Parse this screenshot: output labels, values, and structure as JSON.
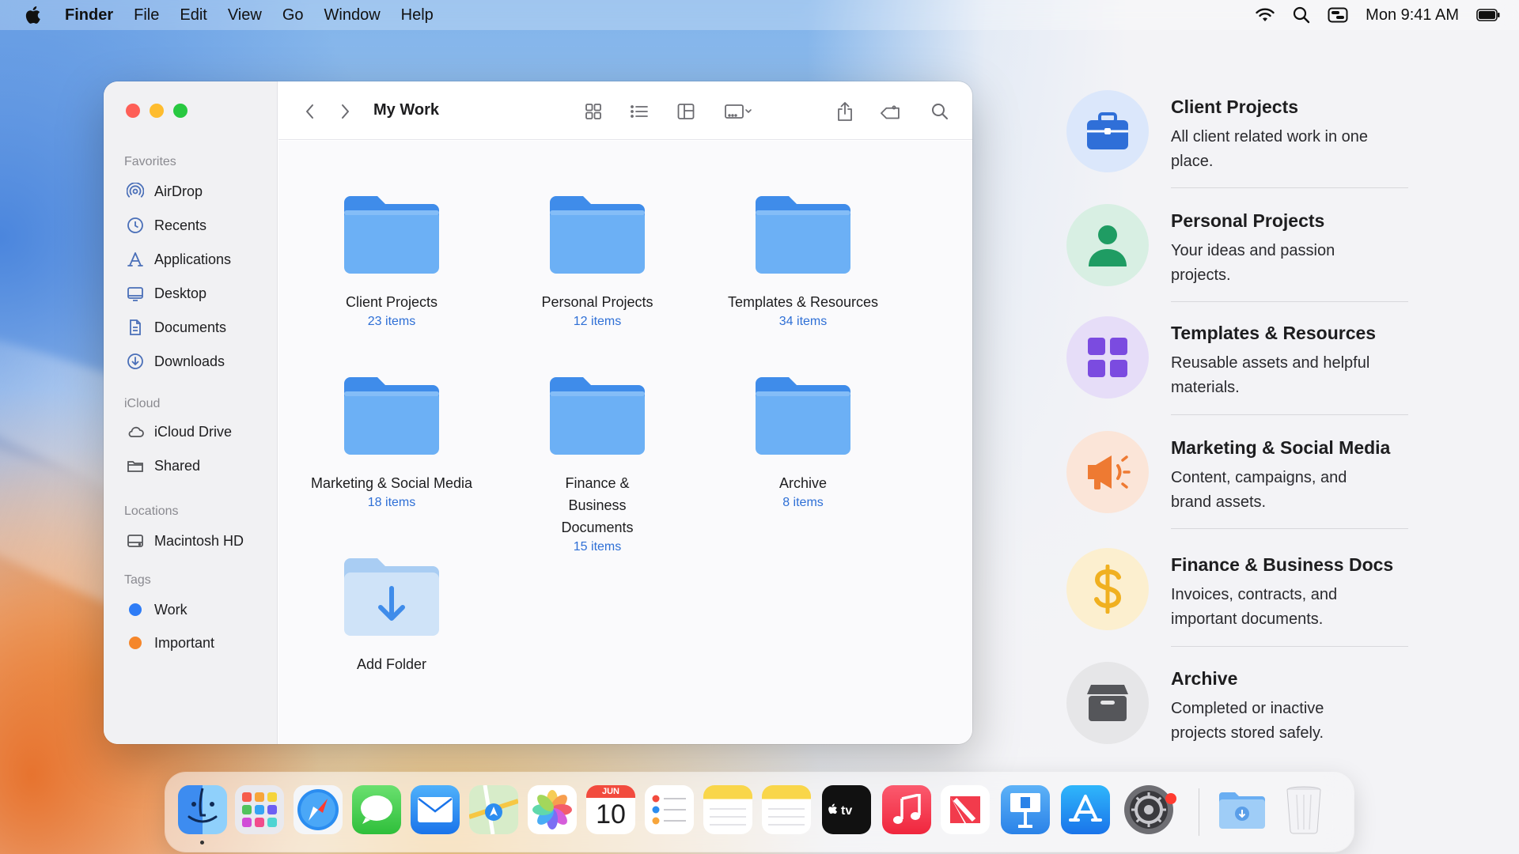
{
  "menubar": {
    "app_name": "Finder",
    "menus": [
      "File",
      "Edit",
      "View",
      "Go",
      "Window",
      "Help"
    ],
    "clock": "Mon 9:41 AM"
  },
  "window": {
    "title": "My Work",
    "sidebar": {
      "favorites_heading": "Favorites",
      "favorites": [
        {
          "label": "AirDrop",
          "icon": "airdrop-icon"
        },
        {
          "label": "Recents",
          "icon": "clock-icon"
        },
        {
          "label": "Applications",
          "icon": "applications-icon"
        },
        {
          "label": "Desktop",
          "icon": "desktop-icon"
        },
        {
          "label": "Documents",
          "icon": "document-icon"
        },
        {
          "label": "Downloads",
          "icon": "download-icon"
        }
      ],
      "icloud_heading": "iCloud",
      "icloud": [
        {
          "label": "iCloud Drive",
          "icon": "cloud-icon"
        },
        {
          "label": "Shared",
          "icon": "shared-folder-icon"
        }
      ],
      "locations_heading": "Locations",
      "locations": [
        {
          "label": "Macintosh HD",
          "icon": "hard-drive-icon"
        }
      ],
      "tags_heading": "Tags",
      "tags": [
        {
          "label": "Work",
          "color": "#2e7cf6"
        },
        {
          "label": "Important",
          "color": "#f5862a"
        }
      ]
    },
    "folders": [
      {
        "name": "Client Projects",
        "count": "23 items"
      },
      {
        "name": "Personal Projects",
        "count": "12 items"
      },
      {
        "name": "Templates & Resources",
        "count": "34 items"
      },
      {
        "name": "Marketing & Social Media",
        "count": "18 items"
      },
      {
        "name": "Finance & Business Documents",
        "count": "15 items"
      },
      {
        "name": "Archive",
        "count": "8 items"
      }
    ],
    "add_folder_label": "Add Folder"
  },
  "panel": [
    {
      "title": "Client Projects",
      "desc": "All client related work in one place.",
      "icon": "briefcase-icon",
      "bg": "#dbe7fb",
      "color": "#2f6fd8"
    },
    {
      "title": "Personal Projects",
      "desc": "Your ideas and passion projects.",
      "icon": "person-icon",
      "bg": "#d8efe3",
      "color": "#1f9c63"
    },
    {
      "title": "Templates & Resources",
      "desc": "Reusable assets and helpful materials.",
      "icon": "grid-icon",
      "bg": "#e6ddf8",
      "color": "#7b4be0"
    },
    {
      "title": "Marketing & Social Media",
      "desc": "Content, campaigns, and brand assets.",
      "icon": "megaphone-icon",
      "bg": "#fbe5d8",
      "color": "#ee7a32"
    },
    {
      "title": "Finance & Business Docs",
      "desc": "Invoices, contracts, and important documents.",
      "icon": "dollar-icon",
      "bg": "#fcefcf",
      "color": "#f0b020"
    },
    {
      "title": "Archive",
      "desc": "Completed or inactive projects stored safely.",
      "icon": "archive-box-icon",
      "bg": "#e6e6e8",
      "color": "#55565a"
    }
  ],
  "dock": {
    "calendar_month": "JUN",
    "calendar_day": "10",
    "apps": [
      "finder-icon",
      "launchpad-icon",
      "safari-icon",
      "messages-icon",
      "mail-icon",
      "maps-icon",
      "photos-icon",
      "calendar-icon",
      "reminders-icon",
      "notes-icon",
      "notes-icon",
      "apple-tv-icon",
      "music-icon",
      "news-icon",
      "keynote-icon",
      "app-store-icon",
      "system-settings-icon",
      "downloads-folder-icon",
      "trash-icon"
    ]
  }
}
